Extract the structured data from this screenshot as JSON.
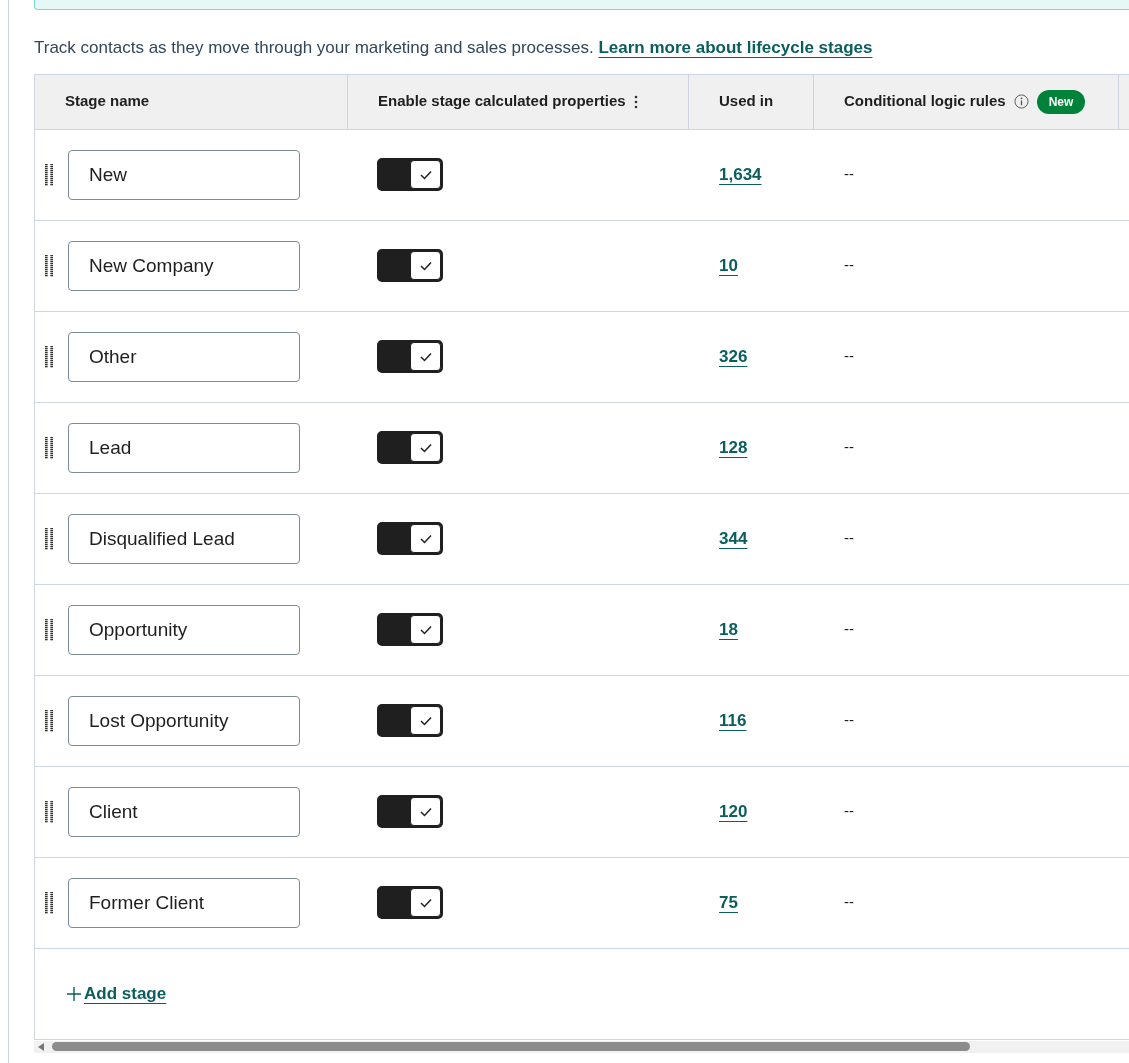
{
  "intro": {
    "text": "Track contacts as they move through your marketing and sales processes.",
    "link": "Learn more about lifecycle stages"
  },
  "table": {
    "columns": [
      {
        "label": "Stage name"
      },
      {
        "label": "Enable stage calculated properties",
        "menu": true
      },
      {
        "label": "Used in"
      },
      {
        "label": "Conditional logic rules",
        "info": true,
        "badge": "New"
      }
    ],
    "rows": [
      {
        "name": "New",
        "enabled": true,
        "used_in": "1,634",
        "rules": "--"
      },
      {
        "name": "New Company",
        "enabled": true,
        "used_in": "10",
        "rules": "--"
      },
      {
        "name": "Other",
        "enabled": true,
        "used_in": "326",
        "rules": "--"
      },
      {
        "name": "Lead",
        "enabled": true,
        "used_in": "128",
        "rules": "--"
      },
      {
        "name": "Disqualified Lead",
        "enabled": true,
        "used_in": "344",
        "rules": "--"
      },
      {
        "name": "Opportunity",
        "enabled": true,
        "used_in": "18",
        "rules": "--"
      },
      {
        "name": "Lost Opportunity",
        "enabled": true,
        "used_in": "116",
        "rules": "--"
      },
      {
        "name": "Client",
        "enabled": true,
        "used_in": "120",
        "rules": "--"
      },
      {
        "name": "Former Client",
        "enabled": true,
        "used_in": "75",
        "rules": "--"
      }
    ],
    "add_button": "Add stage"
  }
}
